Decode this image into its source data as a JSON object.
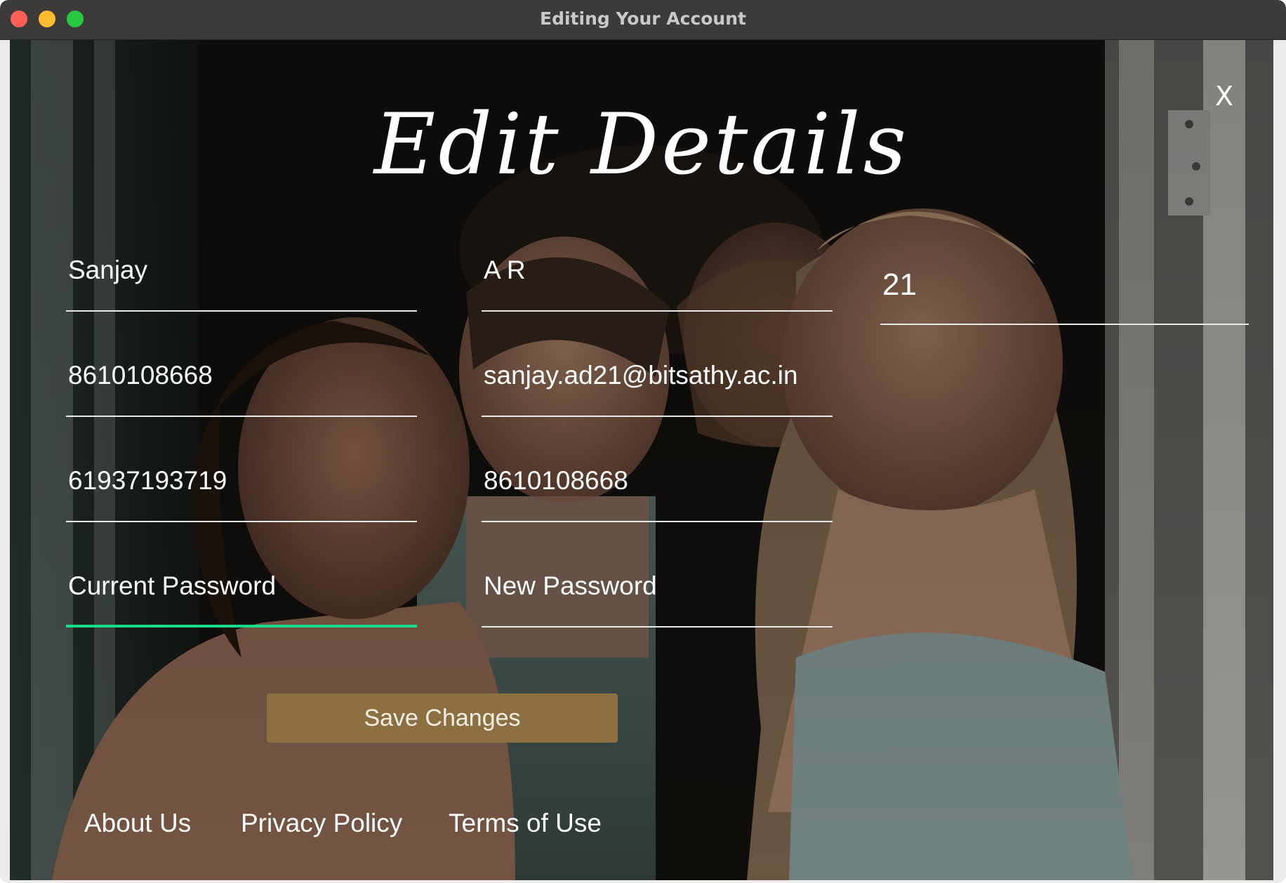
{
  "window": {
    "title": "Editing Your Account"
  },
  "dialog": {
    "close_label": "X",
    "heading": "Edit Details"
  },
  "fields": {
    "first_name": "Sanjay",
    "last_name": "A R",
    "age": "21",
    "phone": "8610108668",
    "email": "sanjay.ad21@bitsathy.ac.in",
    "id_number": "61937193719",
    "alt_phone": "8610108668",
    "current_password_placeholder": "Current Password",
    "new_password_placeholder": "New Password"
  },
  "actions": {
    "save_label": "Save Changes"
  },
  "footer": {
    "about": "About Us",
    "privacy": "Privacy Policy",
    "terms": "Terms of Use"
  },
  "colors": {
    "accent_focus": "#19d98a",
    "save_button": "#8d7042"
  }
}
